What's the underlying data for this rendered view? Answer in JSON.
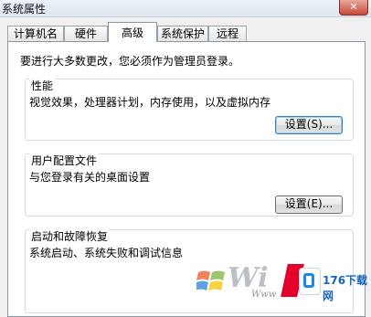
{
  "window": {
    "title": "系统属性",
    "close_glyph": "✕"
  },
  "tabs": [
    {
      "label": "计算机名",
      "active": false
    },
    {
      "label": "硬件",
      "active": false
    },
    {
      "label": "高级",
      "active": true
    },
    {
      "label": "系统保护",
      "active": false
    },
    {
      "label": "远程",
      "active": false
    }
  ],
  "admin_note": "要进行大多数更改，您必须作为管理员登录。",
  "performance": {
    "title": "性能",
    "description": "视觉效果，处理器计划，内存使用，以及虚拟内存",
    "button": "设置(S)..."
  },
  "user_profiles": {
    "title": "用户配置文件",
    "description": "与您登录有关的桌面设置",
    "button": "设置(E)..."
  },
  "startup_recovery": {
    "title": "启动和故障恢复",
    "description": "系统启动、系统失败和调试信息"
  },
  "watermark": {
    "brand_text": "Wi",
    "site_text": "176下载网",
    "small_text": "Www"
  },
  "colors": {
    "accent": "#3c7fb1",
    "close": "#c8483a"
  }
}
